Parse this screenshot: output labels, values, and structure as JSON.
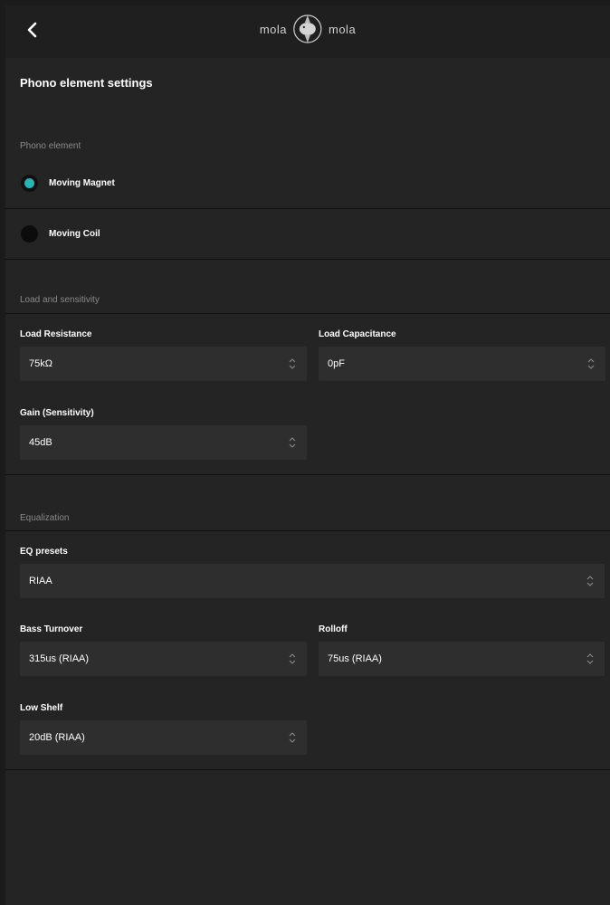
{
  "header": {
    "logo_left": "mola",
    "logo_right": "mola"
  },
  "page_title": "Phono element settings",
  "phono_element": {
    "section_label": "Phono element",
    "options": [
      {
        "label": "Moving Magnet",
        "checked": true
      },
      {
        "label": "Moving Coil",
        "checked": false
      }
    ]
  },
  "load_sensitivity": {
    "section_label": "Load and sensitivity",
    "load_resistance": {
      "label": "Load Resistance",
      "value": "75kΩ"
    },
    "load_capacitance": {
      "label": "Load Capacitance",
      "value": "0pF"
    },
    "gain": {
      "label": "Gain (Sensitivity)",
      "value": "45dB"
    }
  },
  "equalization": {
    "section_label": "Equalization",
    "eq_presets": {
      "label": "EQ presets",
      "value": "RIAA"
    },
    "bass_turnover": {
      "label": "Bass Turnover",
      "value": "315us (RIAA)"
    },
    "rolloff": {
      "label": "Rolloff",
      "value": "75us (RIAA)"
    },
    "low_shelf": {
      "label": "Low Shelf",
      "value": "20dB (RIAA)"
    }
  },
  "colors": {
    "accent": "#27b3b3",
    "background": "#242424",
    "field": "#2e2e2e"
  }
}
